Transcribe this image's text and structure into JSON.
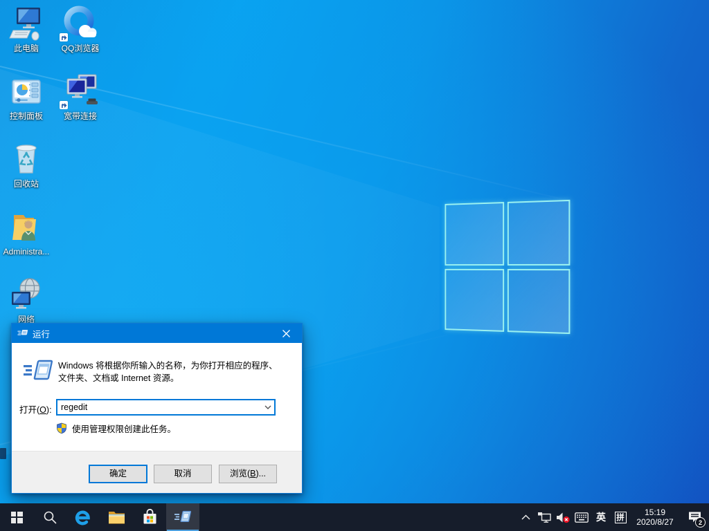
{
  "colors": {
    "accent": "#0078d7",
    "taskbar_bg": "#161d2b",
    "wallpaper_left": "#0aa3ef",
    "wallpaper_right": "#1152c3",
    "logo_border": "#a0f5f0"
  },
  "desktop": {
    "icons": [
      {
        "name": "this-pc",
        "label": "此电脑"
      },
      {
        "name": "qq-browser",
        "label": "QQ浏览器"
      },
      {
        "name": "control-panel",
        "label": "控制面板"
      },
      {
        "name": "broadband-connection",
        "label": "宽带连接"
      },
      {
        "name": "recycle-bin",
        "label": "回收站"
      },
      {
        "name": "administrator-folder",
        "label": "Administra..."
      },
      {
        "name": "network",
        "label": "网络"
      }
    ]
  },
  "run_dialog": {
    "title": "运行",
    "description_line1": "Windows 将根据你所输入的名称，为你打开相应的程序、",
    "description_line2": "文件夹、文档或 Internet 资源。",
    "open_label_prefix": "打开(",
    "open_label_key": "O",
    "open_label_suffix": "):",
    "input_value": "regedit",
    "admin_note": "使用管理权限创建此任务。",
    "buttons": {
      "ok": "确定",
      "cancel": "取消",
      "browse_prefix": "浏览(",
      "browse_key": "B",
      "browse_suffix": ")..."
    }
  },
  "taskbar": {
    "icons": [
      "start-icon",
      "search-icon",
      "edge-icon",
      "file-explorer-icon",
      "store-icon",
      "run-window-icon"
    ],
    "tray": {
      "ime_latin": "英",
      "ime_pinyin": "拼",
      "time": "15:19",
      "date": "2020/8/27",
      "notification_badge": "2"
    }
  }
}
